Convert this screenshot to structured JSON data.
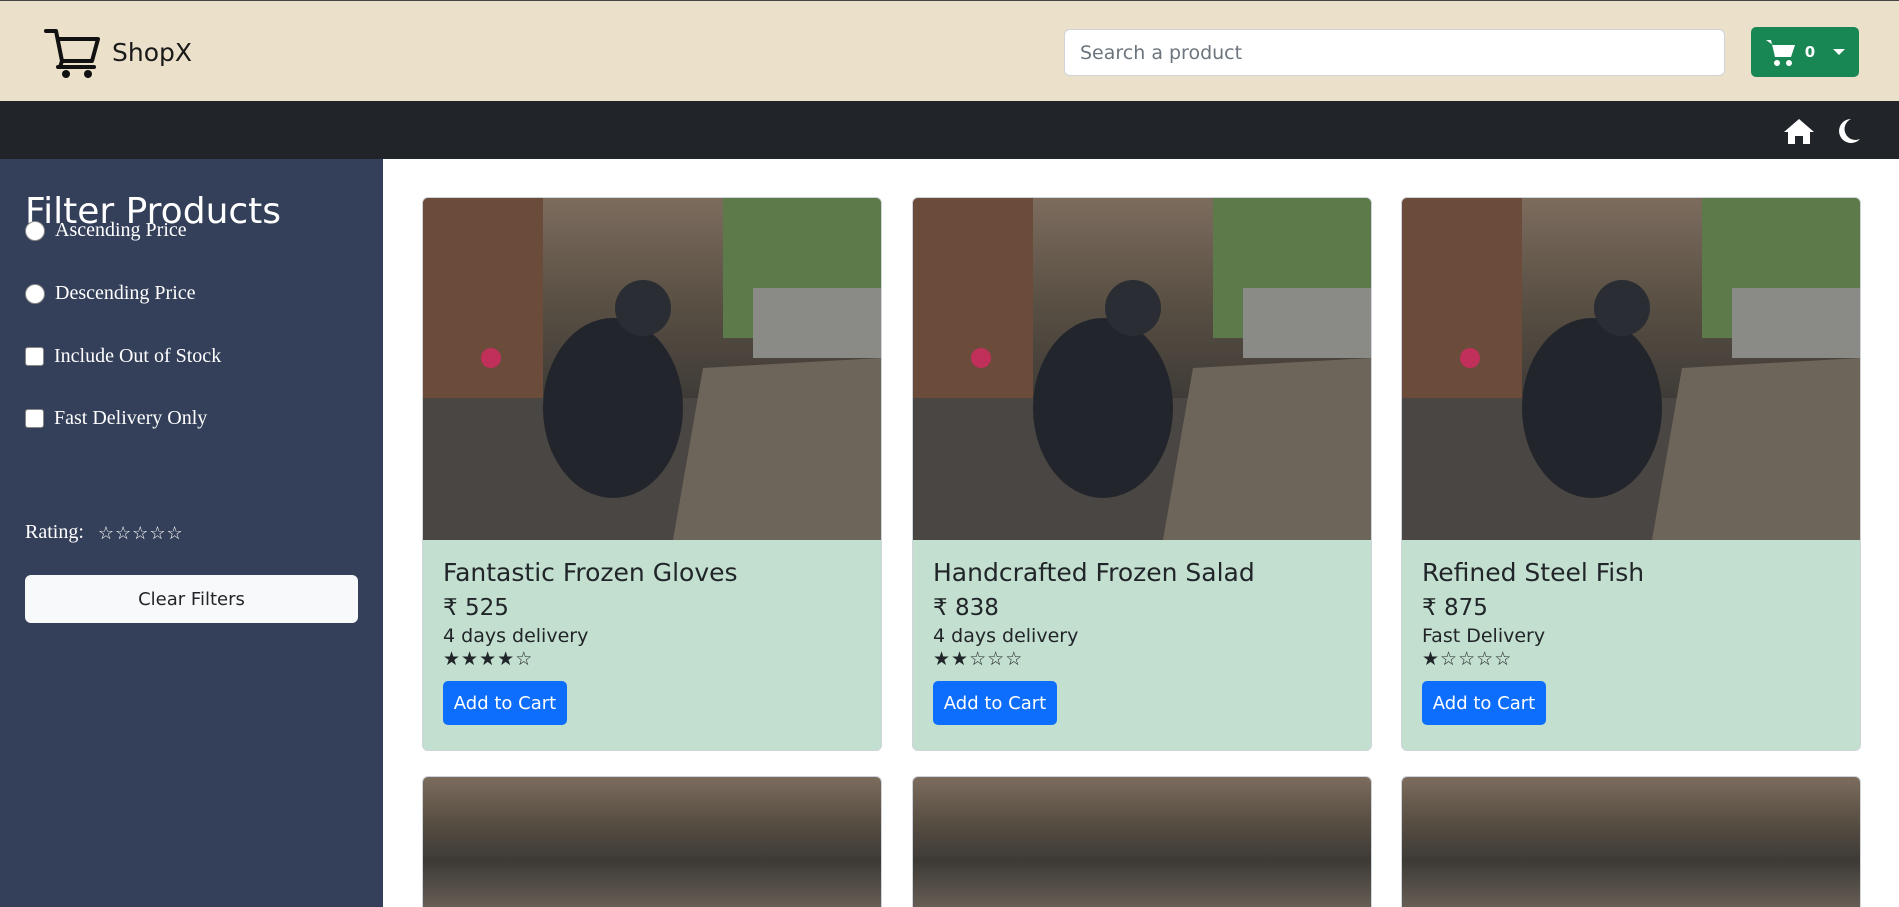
{
  "header": {
    "brand_name": "ShopX",
    "search_placeholder": "Search a product",
    "cart_count": "0",
    "icons": {
      "brand": "cart-icon",
      "cart": "cart-icon",
      "dropdown": "caret-down-icon"
    }
  },
  "nav": {
    "icons": [
      "home-icon",
      "moon-icon"
    ]
  },
  "sidebar": {
    "title": "Filter Products",
    "options": [
      {
        "label": "Ascending Price",
        "type": "radio"
      },
      {
        "label": "Descending Price",
        "type": "radio"
      },
      {
        "label": "Include Out of Stock",
        "type": "checkbox"
      },
      {
        "label": "Fast Delivery Only",
        "type": "checkbox"
      }
    ],
    "rating_label": "Rating:",
    "rating_value": 0,
    "rating_max": 5,
    "clear_label": "Clear Filters"
  },
  "products": [
    {
      "name": "Fantastic Frozen Gloves",
      "price": "₹ 525",
      "delivery": "4 days delivery",
      "rating": 4,
      "button": "Add to Cart"
    },
    {
      "name": "Handcrafted Frozen Salad",
      "price": "₹ 838",
      "delivery": "4 days delivery",
      "rating": 2,
      "button": "Add to Cart"
    },
    {
      "name": "Refined Steel Fish",
      "price": "₹ 875",
      "delivery": "Fast Delivery",
      "rating": 1,
      "button": "Add to Cart"
    }
  ],
  "colors": {
    "header_bg": "#ebe1cb",
    "nav_bg": "#212529",
    "sidebar_bg": "#343f59",
    "card_bg": "#c3dfcf",
    "primary": "#0d6efd",
    "success": "#198754"
  }
}
